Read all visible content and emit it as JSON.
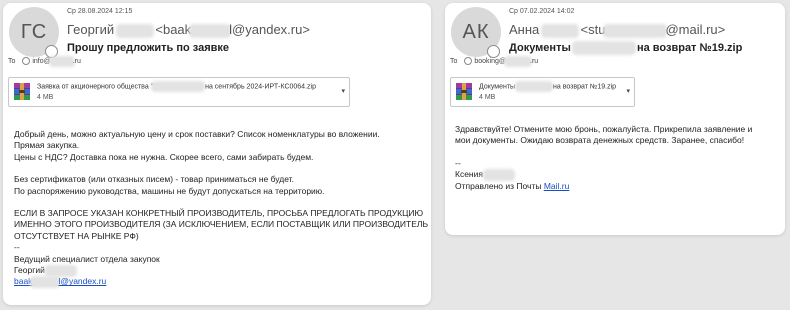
{
  "left": {
    "avatar_initials": "ГС",
    "date": "Ср 28.08.2024 12:15",
    "sender_name": "Георгий",
    "sender_email_start": "<baak",
    "sender_email_end": "l@yandex.ru>",
    "subject": "Прошу предложить по заявке",
    "to_label": "To",
    "to_address_start": "info@",
    "to_address_end": ".ru",
    "attachment_name_start": "Заявка от акционерного общества \"",
    "attachment_name_end": "на сентябрь 2024-ИРТ-КС0064.zip",
    "attachment_size": "4 MB",
    "body_lines": [
      "Добрый день, можно актуальную цену и срок поставки? Список номенклатуры во вложении.",
      "Прямая закупка.",
      "Цены с НДС? Доставка пока не нужна. Скорее всего, сами забирать будем.",
      "",
      "Без сертификатов (или отказных писем) - товар приниматься не будет.",
      "По распоряжению руководства, машины не будут допускаться на территорию.",
      "",
      "ЕСЛИ В ЗАПРОСЕ УКАЗАН КОНКРЕТНЫЙ ПРОИЗВОДИТЕЛЬ, ПРОСЬБА ПРЕДЛОГАТЬ ПРОДУКЦИЮ",
      "ИМЕННО ЭТОГО ПРОИЗВОДИТЕЛЯ (ЗА ИСКЛЮЧЕНИЕМ, ЕСЛИ ПОСТАВЩИК ИЛИ ПРОИЗВОДИТЕЛЬ",
      "ОТСУТСТВУЕТ НА РЫНКЕ РФ)",
      "--",
      "Ведущий специалист отдела закупок"
    ],
    "signature_name": "Георгий",
    "signature_email_start": "baak",
    "signature_email_end": "l@yandex.ru"
  },
  "right": {
    "avatar_initials": "АК",
    "date": "Ср 07.02.2024 14:02",
    "sender_name": "Анна",
    "sender_email_start": "<stu",
    "sender_email_end": "@mail.ru>",
    "subject_start": "Документы",
    "subject_end": "на возврат №19.zip",
    "to_label": "To",
    "to_address_start": "booking@",
    "to_address_end": ".ru",
    "attachment_name_start": "Документы",
    "attachment_name_end": "на возврат №19.zip",
    "attachment_size": "4 MB",
    "body_lines": [
      "Здравствуйте! Отмените мою бронь, пожалуйста. Прикрепила заявление и",
      "мои документы. Ожидаю возврата денежных средств. Заранее, спасибо!",
      "",
      "--"
    ],
    "signature_name": "Ксения",
    "sent_from_prefix": "Отправлено из Почты ",
    "sent_from_link": "Mail.ru"
  }
}
